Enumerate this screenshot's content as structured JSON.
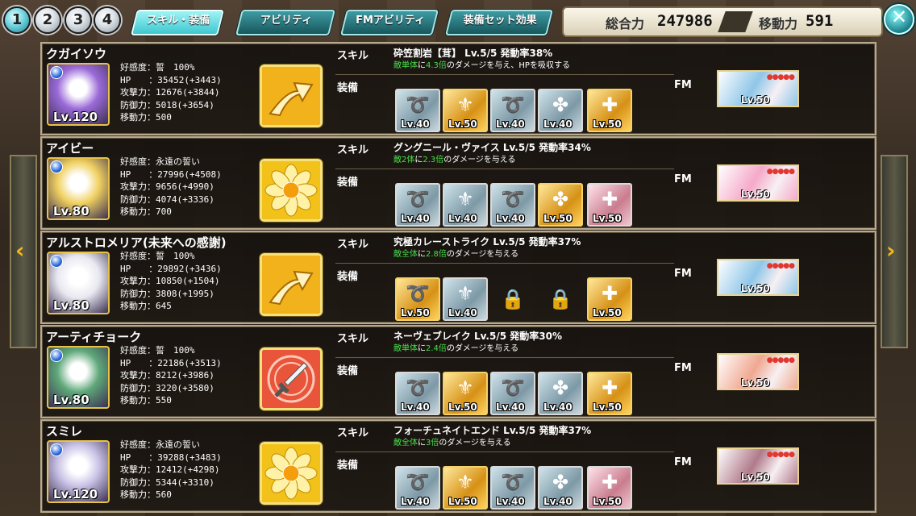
{
  "top_buttons": [
    "1",
    "2",
    "3",
    "4"
  ],
  "tabs": [
    "スキル・装備",
    "アビリティ",
    "FMアビリティ",
    "装備セット効果"
  ],
  "totals": {
    "power_label": "総合力",
    "power_value": "247986",
    "move_label": "移動力",
    "move_value": "591"
  },
  "close_glyph": "✕",
  "nav": {
    "left_arrow": "‹",
    "right_arrow": "›"
  },
  "labels": {
    "skill": "スキル",
    "equip": "装備",
    "fm": "FM"
  },
  "characters": [
    {
      "name": "クガイソウ",
      "level": "Lv.120",
      "stats": [
        "好感度：誓　100%",
        "HP　　：35452(+3443)",
        "攻撃力：12676(+3844)",
        "防御力：5018(+3654)",
        "移動力：500"
      ],
      "skill_icon": "arrow-icon",
      "skill_name": "砕笠割岩【茸】 Lv.5/5 発動率38%",
      "skill_desc": {
        "target": "敵単体",
        "a": "に",
        "mult": "4.3倍",
        "b": "のダメージを与え、HPを吸収する"
      },
      "equipment": [
        {
          "lv": "Lv.40",
          "tier": "silver"
        },
        {
          "lv": "Lv.50",
          "tier": "gold"
        },
        {
          "lv": "Lv.40",
          "tier": "silver"
        },
        {
          "lv": "Lv.40",
          "tier": "silver"
        },
        {
          "lv": "Lv.50",
          "tier": "gold"
        }
      ],
      "fm_level": "Lv.50"
    },
    {
      "name": "アイビー",
      "level": "Lv.80",
      "stats": [
        "好感度：永遠の誓い",
        "HP　　：27996(+4508)",
        "攻撃力：9656(+4990)",
        "防御力：4074(+3336)",
        "移動力：700"
      ],
      "skill_icon": "flower-icon",
      "skill_name": "グングニール・ヴァイス Lv.5/5 発動率34%",
      "skill_desc": {
        "target": "敵2体",
        "a": "に",
        "mult": "2.3倍",
        "b": "のダメージを与える"
      },
      "equipment": [
        {
          "lv": "Lv.40",
          "tier": "silver"
        },
        {
          "lv": "Lv.40",
          "tier": "silver"
        },
        {
          "lv": "Lv.40",
          "tier": "silver"
        },
        {
          "lv": "Lv.50",
          "tier": "gold"
        },
        {
          "lv": "Lv.50",
          "tier": "pink"
        }
      ],
      "fm_level": "Lv.50"
    },
    {
      "name": "アルストロメリア(未来への感謝)",
      "level": "Lv.80",
      "stats": [
        "好感度：誓　100%",
        "HP　　：29892(+3436)",
        "攻撃力：10850(+1504)",
        "防御力：3808(+1995)",
        "移動力：645"
      ],
      "skill_icon": "arrow-icon",
      "skill_name": "究極カレーストライク Lv.5/5 発動率37%",
      "skill_desc": {
        "target": "敵全体",
        "a": "に",
        "mult": "2.8倍",
        "b": "のダメージを与える"
      },
      "equipment": [
        {
          "lv": "Lv.50",
          "tier": "gold"
        },
        {
          "lv": "Lv.40",
          "tier": "silver"
        },
        {
          "lv": "",
          "tier": "lock"
        },
        {
          "lv": "",
          "tier": "lock"
        },
        {
          "lv": "Lv.50",
          "tier": "gold"
        }
      ],
      "fm_level": "Lv.50"
    },
    {
      "name": "アーティチョーク",
      "level": "Lv.80",
      "stats": [
        "好感度：誓　100%",
        "HP　　：22186(+3513)",
        "攻撃力：8212(+3986)",
        "防御力：3220(+3580)",
        "移動力：550"
      ],
      "skill_icon": "sword-icon",
      "skill_name": "ネーヴェブレイク Lv.5/5 発動率30%",
      "skill_desc": {
        "target": "敵単体",
        "a": "に",
        "mult": "2.4倍",
        "b": "のダメージを与える"
      },
      "equipment": [
        {
          "lv": "Lv.40",
          "tier": "silver"
        },
        {
          "lv": "Lv.50",
          "tier": "gold"
        },
        {
          "lv": "Lv.40",
          "tier": "silver"
        },
        {
          "lv": "Lv.40",
          "tier": "silver"
        },
        {
          "lv": "Lv.50",
          "tier": "gold"
        }
      ],
      "fm_level": "Lv.50"
    },
    {
      "name": "スミレ",
      "level": "Lv.120",
      "stats": [
        "好感度：永遠の誓い",
        "HP　　：39288(+3483)",
        "攻撃力：12412(+4298)",
        "防御力：5344(+3310)",
        "移動力：560"
      ],
      "skill_icon": "flower-icon",
      "skill_name": "フォーチュネイトエンド Lv.5/5 発動率37%",
      "skill_desc": {
        "target": "敵全体",
        "a": "に",
        "mult": "3倍",
        "b": "のダメージを与える"
      },
      "equipment": [
        {
          "lv": "Lv.40",
          "tier": "silver"
        },
        {
          "lv": "Lv.50",
          "tier": "gold"
        },
        {
          "lv": "Lv.40",
          "tier": "silver"
        },
        {
          "lv": "Lv.40",
          "tier": "silver"
        },
        {
          "lv": "Lv.50",
          "tier": "pink"
        }
      ],
      "fm_level": "Lv.50"
    }
  ],
  "portrait_colors": [
    "#9a6ad8",
    "#f0d060",
    "#e8e8f0",
    "#5fa87a",
    "#c9c2e6"
  ],
  "fm_colors": [
    "#8fc6e8",
    "#f5a9c8",
    "#8fc6e8",
    "#f0a890",
    "#b07a8a"
  ]
}
